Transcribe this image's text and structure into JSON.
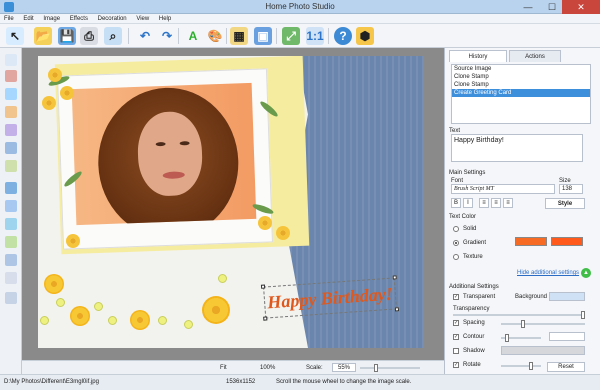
{
  "window": {
    "title": "Home Photo Studio",
    "controls": {
      "minimize": "—",
      "maximize": "☐",
      "close": "✕"
    }
  },
  "menu": [
    "File",
    "Edit",
    "Image",
    "Effects",
    "Decoration",
    "View",
    "Help"
  ],
  "toolbar": {
    "buttons": [
      "pointer-icon",
      "open-folder-icon",
      "open-folder-icon",
      "save-icon",
      "print-icon",
      "scanner-icon",
      "undo-icon",
      "redo-icon",
      "text-icon",
      "palette-icon",
      "image-icon",
      "frame-icon",
      "fit-icon",
      "zoom-icon",
      "help-icon",
      "cube-icon"
    ]
  },
  "canvas": {
    "greeting_text": "Happy Birthday!"
  },
  "bottom_controls": {
    "fit": "Fit",
    "zoom100": "100%",
    "scale_label": "Scale:",
    "scale_value": "55%"
  },
  "status": {
    "path": "D:\\My Photos\\Different\\E3mgl0if.jpg",
    "dimensions": "1536x1152",
    "hint": "Scroll the mouse wheel to change the image scale."
  },
  "right_panel": {
    "tabs": [
      "History",
      "Actions"
    ],
    "history_items": [
      "Source Image",
      "Clone Stamp",
      "Clone Stamp",
      "Create Greeting Card"
    ],
    "text_label": "Text",
    "text_value": "Happy Birthday!",
    "main_settings": "Main Settings",
    "font_label": "Font",
    "font_value": "Brush Script MT",
    "size_label": "Size",
    "size_value": "138",
    "format_buttons": [
      "B",
      "I",
      "≡",
      "≡",
      "≡"
    ],
    "style_button": "Style",
    "text_color": "Text Color",
    "solid": "Solid",
    "gradient": "Gradient",
    "texture": "Texture",
    "hide_settings": "Hide additional settings",
    "additional_settings": "Additional Settings",
    "transparent": "Transparent",
    "background": "Background",
    "transparency": "Transparency",
    "spacing": "Spacing",
    "contour": "Contour",
    "shadow": "Shadow",
    "rotate": "Rotate",
    "reset": "Reset"
  },
  "colors": {
    "accent": "#3d8fdc",
    "gradient1": "#f76a24",
    "gradient2": "#ff5a1c",
    "text": "#e0581b"
  }
}
